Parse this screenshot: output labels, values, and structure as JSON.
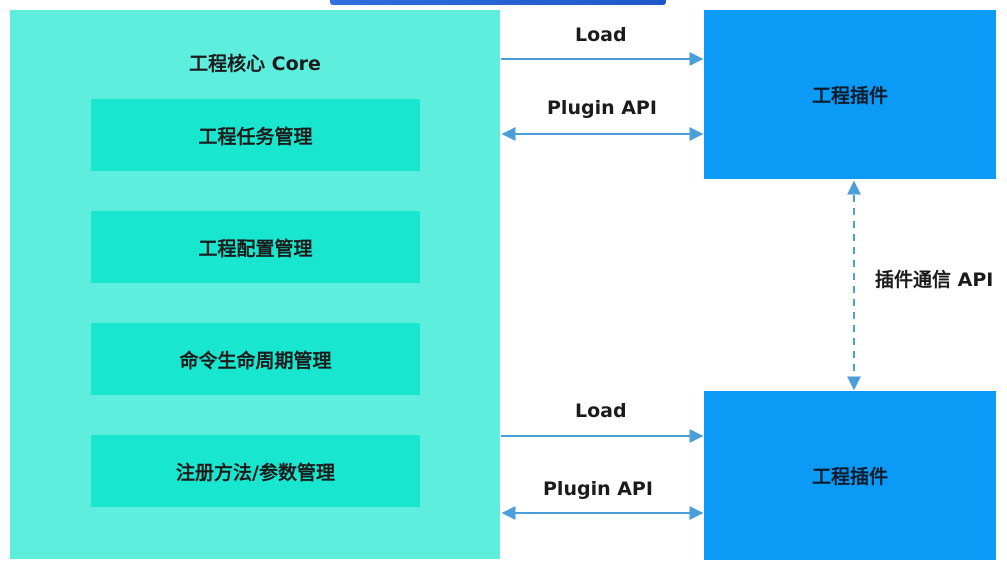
{
  "core": {
    "title": "工程核心 Core",
    "modules": [
      "工程任务管理",
      "工程配置管理",
      "命令生命周期管理",
      "注册方法/参数管理"
    ]
  },
  "plugins": [
    {
      "label": "工程插件"
    },
    {
      "label": "工程插件"
    }
  ],
  "connections": {
    "top_load": "Load",
    "top_api": "Plugin API",
    "bottom_load": "Load",
    "bottom_api": "Plugin API",
    "inter_plugin": "插件通信 API"
  },
  "colors": {
    "core_bg": "#5eeedd",
    "module_bg": "#18e6cf",
    "plugin_bg": "#0b9bf7",
    "arrow": "#4a9fd8"
  }
}
